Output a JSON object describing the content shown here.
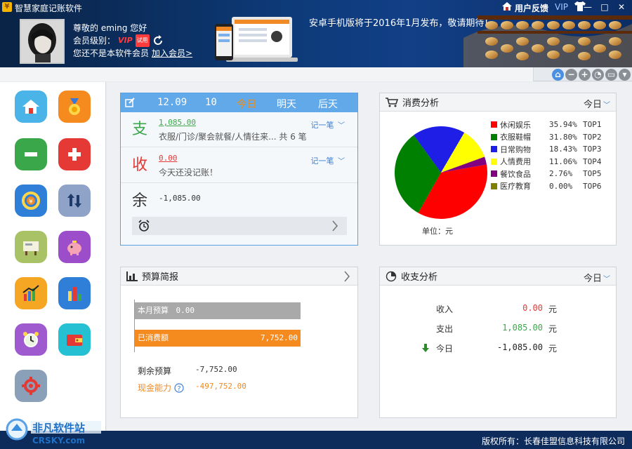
{
  "window": {
    "title": "智慧家庭记账软件",
    "feedback": "用户反馈",
    "vip": "VIP",
    "controls": [
      "—",
      "□",
      "✕"
    ]
  },
  "user": {
    "greeting": "尊敬的 eming 您好",
    "level_label": "会员级别：",
    "vip_badge": "VIP",
    "trial_badge": "试用",
    "not_member": "您还不是本软件会员",
    "join_link": "加入会员>"
  },
  "banner": {
    "text": "安卓手机版将于2016年1月发布，敬请期待！"
  },
  "daily": {
    "dates": [
      "12.09",
      "10",
      "今日",
      "明天",
      "后天"
    ],
    "active_date_index": 2,
    "expense": {
      "char": "支",
      "amount": "1,085.00",
      "desc": "衣服/门诊/聚会就餐/人情往来...  共 6 笔",
      "record": "记一笔"
    },
    "income": {
      "char": "收",
      "amount": "0.00",
      "desc": "今天还没记账！",
      "record": "记一笔"
    },
    "balance": {
      "char": "余",
      "amount": "-1,085.00"
    }
  },
  "consume": {
    "title": "消费分析",
    "period": "今日",
    "unit": "单位：元",
    "chart_data": {
      "type": "pie",
      "categories": [
        "休闲娱乐",
        "衣服鞋帽",
        "日常购物",
        "人情费用",
        "餐饮食品",
        "医疗教育"
      ],
      "values": [
        35.94,
        31.8,
        18.43,
        11.06,
        2.76,
        0.0
      ],
      "labels_pct": [
        "35.94%",
        "31.80%",
        "18.43%",
        "11.06%",
        "2.76%",
        "0.00%"
      ],
      "ranks": [
        "TOP1",
        "TOP2",
        "TOP3",
        "TOP4",
        "TOP5",
        "TOP6"
      ],
      "colors": [
        "#ff0000",
        "#008000",
        "#1e1ee6",
        "#ffff00",
        "#800080",
        "#808000"
      ]
    }
  },
  "budget": {
    "title": "预算简报",
    "month_budget_label": "本月预算",
    "month_budget_value": "0.00",
    "spent_label": "已消费额",
    "spent_value": "7,752.00",
    "remaining_label": "剩余预算",
    "remaining_value": "-7,752.00",
    "cash_label": "现金能力",
    "cash_value": "-497,752.00"
  },
  "income_analysis": {
    "title": "收支分析",
    "period": "今日",
    "rows": [
      {
        "label": "收入",
        "value": "0.00",
        "unit": "元"
      },
      {
        "label": "支出",
        "value": "1,085.00",
        "unit": "元"
      },
      {
        "label": "今日",
        "value": "-1,085.00",
        "unit": "元"
      }
    ]
  },
  "footer": {
    "copyright": "版权所有：长春佳盟信息科技有限公司"
  },
  "watermark": {
    "name": "非凡软件站",
    "domain": "CRSKY.com"
  }
}
